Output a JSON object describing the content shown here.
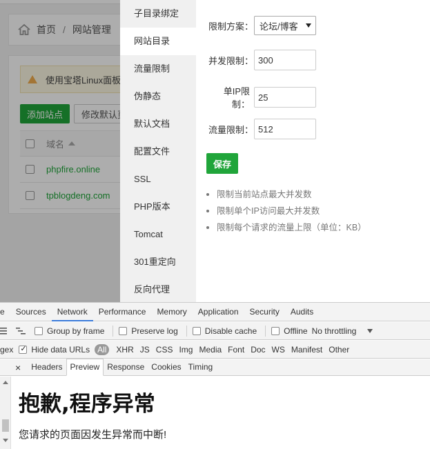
{
  "site": {
    "breadcrumb": {
      "home": "首页",
      "separator": "/",
      "current": "网站管理"
    },
    "warning": "使用宝塔Linux面板创",
    "buttons": {
      "add_site": "添加站点",
      "modify_default": "修改默认页"
    },
    "table": {
      "column_domain": "域名",
      "rows": [
        {
          "domain": "phpfire.online"
        },
        {
          "domain": "tpblogdeng.com"
        }
      ]
    }
  },
  "modal": {
    "tabs": [
      {
        "label": "子目录绑定"
      },
      {
        "label": "网站目录"
      },
      {
        "label": "流量限制"
      },
      {
        "label": "伪静态"
      },
      {
        "label": "默认文档"
      },
      {
        "label": "配置文件"
      },
      {
        "label": "SSL"
      },
      {
        "label": "PHP版本"
      },
      {
        "label": "Tomcat"
      },
      {
        "label": "301重定向"
      },
      {
        "label": "反向代理"
      }
    ],
    "form": {
      "plan_label": "限制方案：",
      "plan_value": "论坛/博客",
      "concurrency_label": "并发限制：",
      "concurrency_value": "300",
      "per_ip_label": "单IP限制：",
      "per_ip_value": "25",
      "traffic_label": "流量限制：",
      "traffic_value": "512"
    },
    "save_label": "保存",
    "tips": [
      "限制当前站点最大并发数",
      "限制单个IP访问最大并发数",
      "限制每个请求的流量上限（单位：KB）"
    ]
  },
  "devtools": {
    "tabs": [
      "e",
      "Sources",
      "Network",
      "Performance",
      "Memory",
      "Application",
      "Security",
      "Audits"
    ],
    "toolbar": {
      "group_by_frame": "Group by frame",
      "preserve_log": "Preserve log",
      "disable_cache": "Disable cache",
      "offline": "Offline",
      "throttling": "No throttling"
    },
    "filter": {
      "regex": "gex",
      "hide_data_urls": "Hide data URLs",
      "all": "All",
      "types": [
        "XHR",
        "JS",
        "CSS",
        "Img",
        "Media",
        "Font",
        "Doc",
        "WS",
        "Manifest",
        "Other"
      ]
    },
    "subtabs": {
      "close": "×",
      "headers": "Headers",
      "preview": "Preview",
      "response": "Response",
      "cookies": "Cookies",
      "timing": "Timing"
    },
    "preview": {
      "heading": "抱歉,程序异常",
      "message": "您请求的页面因发生异常而中断!"
    }
  },
  "colors": {
    "brand_green": "#20a53a",
    "active_tab_underline": "#3879d9"
  }
}
